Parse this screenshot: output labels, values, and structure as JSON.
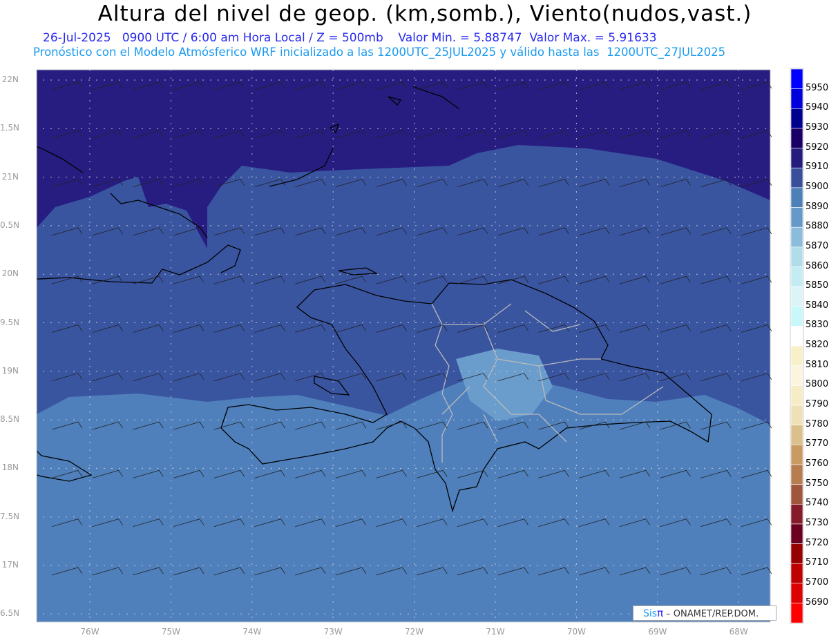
{
  "header": {
    "title": "Altura del nivel de geop. (km,somb.), Viento(nudos,vast.)",
    "subtitle_1": "26-Jul-2025   0900 UTC / 6:00 am Hora Local / Z = 500mb    Valor Min. = 5.88747  Valor Max. = 5.91633",
    "subtitle_2": "Pronóstico con el Modelo Atmósferico WRF inicializado a las 1200UTC_25JUL2025 y válido hasta las  1200UTC_27JUL2025"
  },
  "map": {
    "lat_labels": [
      "22N",
      "1.5N",
      "21N",
      "0.5N",
      "20N",
      "9.5N",
      "19N",
      "8.5N",
      "18N",
      "7.5N",
      "17N",
      "6.5N"
    ],
    "lon_labels": [
      "76W",
      "75W",
      "74W",
      "73W",
      "72W",
      "71W",
      "70W",
      "69W",
      "68W"
    ],
    "fill_colors": {
      "high": "#271d80",
      "mid": "#3a55a0",
      "low": "#4f80bc",
      "patch": "#6a9ccc"
    }
  },
  "colorbar": {
    "labels": [
      "5950",
      "5940",
      "5930",
      "5920",
      "5910",
      "5900",
      "5890",
      "5880",
      "5870",
      "5860",
      "5850",
      "5840",
      "5830",
      "5820",
      "5810",
      "5800",
      "5790",
      "5780",
      "5770",
      "5760",
      "5750",
      "5740",
      "5730",
      "5720",
      "5710",
      "5700",
      "5690"
    ],
    "colors": [
      "#0000ff",
      "#0000dd",
      "#00008f",
      "#1a0066",
      "#251c7e",
      "#3a4f9c",
      "#4d80b8",
      "#6499c8",
      "#8bbcdc",
      "#b0dde9",
      "#c3ecf3",
      "#dcf4f8",
      "#c8f8fa",
      "#ffffff",
      "#f8f0c8",
      "#fbf5e0",
      "#f6ecc6",
      "#f0e0b8",
      "#dcc08c",
      "#c99a62",
      "#b77d4e",
      "#a0563c",
      "#861c2a",
      "#6c0020",
      "#960000",
      "#be0000",
      "#dd0000",
      "#ff0000"
    ]
  },
  "logo": {
    "sis": "Sis",
    "pi": "π",
    "org": "– ONAMET/REP.DOM."
  }
}
